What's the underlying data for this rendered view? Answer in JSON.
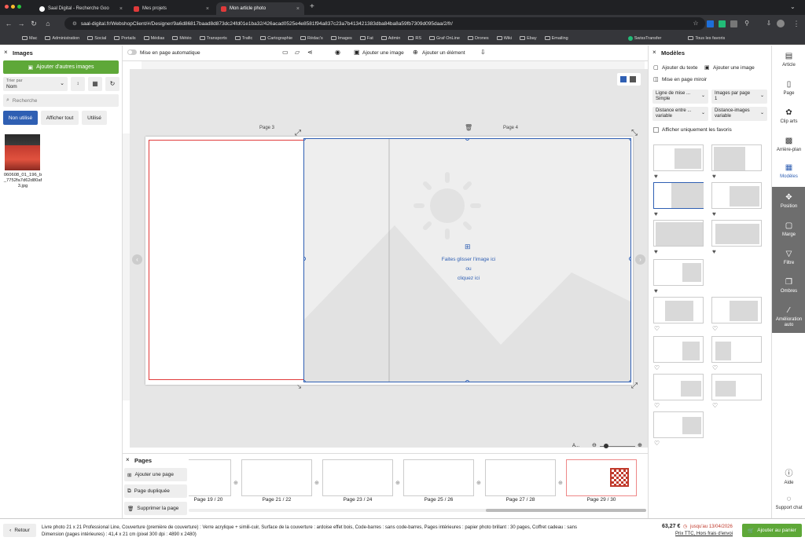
{
  "browser": {
    "tabs": [
      {
        "title": "Saal Digital - Recherche Goo"
      },
      {
        "title": "Mes projets"
      },
      {
        "title": "Mon article photo"
      }
    ],
    "new_tab": "+",
    "url": "saal-digital.fr/WebshopClient/#/Designer/9a6d86817baad8d873dc24fd01e1ba32/426acad0525e4e8581f94a837c23a7b413421383dba84ba8a59fb7309d095daa/2/fr/",
    "bookmarks": [
      "Mac",
      "Administration",
      "Social",
      "Portails",
      "Médias",
      "Météo",
      "Transports",
      "Trafic",
      "Cartographie",
      "Rédac's",
      "Images",
      "Fat",
      "Admin",
      "RS",
      "Graf OnLine",
      "Drones",
      "Wiki",
      "Ebay",
      "Emailing"
    ],
    "bookmark_extra": [
      "SwissTransfer",
      "Tous les favoris"
    ]
  },
  "left": {
    "title": "Images",
    "add_button": "Ajouter d'autres images",
    "sort_label": "Trier par",
    "sort_value": "Nom",
    "search_placeholder": "Recherche",
    "filters": [
      "Non utilisé",
      "Afficher tout",
      "Utilisé"
    ],
    "image_caption": "060608_01_196_b_7752fa7d62d80af3.jpg"
  },
  "toolbar": {
    "auto_layout": "Mise en page automatique",
    "add_image": "Ajouter une image",
    "add_element": "Ajouter un élément"
  },
  "canvas": {
    "page_left": "Page 3",
    "page_right": "Page 4",
    "drop_line1": "Faites glisser l'image ici",
    "drop_line2": "ou",
    "drop_line3": "cliquez ici",
    "zoom_label": "A..."
  },
  "right": {
    "title": "Modèles",
    "add_text": "Ajouter du texte",
    "add_image": "Ajouter une image",
    "mirror": "Mise en page miroir",
    "selects": [
      {
        "label": "Ligne de mise ...",
        "value": "Simple"
      },
      {
        "label": "Images par page",
        "value": "1"
      },
      {
        "label": "Distance entre ...",
        "value": "variable"
      },
      {
        "label": "Distance-images",
        "value": "variable"
      }
    ],
    "favorites_only": "Afficher uniquement les favoris"
  },
  "sidetools": [
    "Article",
    "Page",
    "Clip arts",
    "Arrière-plan",
    "Modèles",
    "Position",
    "Marge",
    "Filtre",
    "Ombres",
    "Amélioration auto",
    "Aide",
    "Support chat"
  ],
  "pages": {
    "title": "Pages",
    "add_page": "Ajouter une page",
    "duplicate_page": "Page dupliquée",
    "delete_page": "Supprimer la page",
    "labels": [
      "Page 19 / 20",
      "Page 21 / 22",
      "Page 23 / 24",
      "Page 25 / 26",
      "Page 27 / 28",
      "Page 29 / 30"
    ]
  },
  "footer": {
    "back": "Retour",
    "description_line1": "Livre photo 21 x 21 Professional Line, Couverture (première de couverture) : Verre acrylique + simili-cuir, Surface de la couverture : ardoise effet bois, Code-barres : sans code-barres, Pages intérieures : papier photo brillant : 30 pages, Coffret cadeau : sans",
    "description_line2": "Dimension (pages intérieures) : 41,4 x 21 cm (pixel 300 dpi : 4890 x 2480)",
    "price": "63,27 €",
    "price_until": "jusqu'au 13/04/2026",
    "price_note": "Prix TTC, Hors frais d'envoi",
    "add_to_cart": "Ajouter au panier"
  },
  "colors": {
    "green": "#5ea838",
    "blue": "#2f5fb3",
    "red": "#e03a3a"
  }
}
